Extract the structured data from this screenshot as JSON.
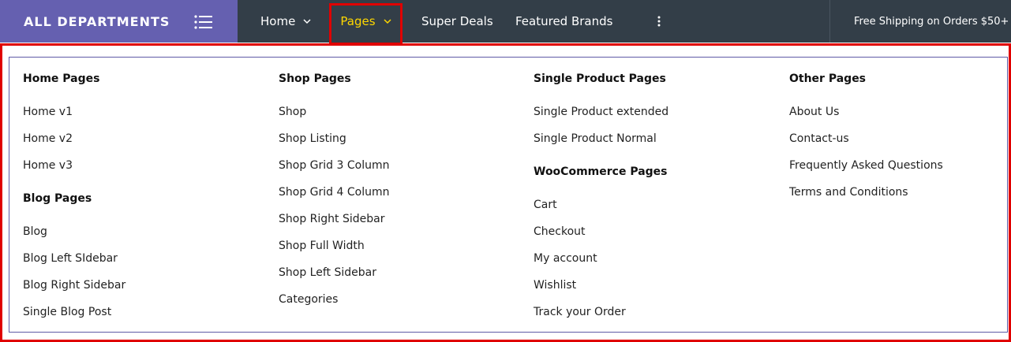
{
  "navbar": {
    "departments_label": "ALL DEPARTMENTS",
    "items": [
      {
        "label": "Home"
      },
      {
        "label": "Pages"
      },
      {
        "label": "Super Deals"
      },
      {
        "label": "Featured Brands"
      }
    ],
    "free_shipping": "Free Shipping on Orders $50+"
  },
  "menu": {
    "columns": [
      {
        "sections": [
          {
            "heading": "Home Pages",
            "links": [
              "Home v1",
              "Home v2",
              "Home v3"
            ]
          },
          {
            "heading": "Blog Pages",
            "links": [
              "Blog",
              "Blog Left SIdebar",
              "Blog Right Sidebar",
              "Single Blog Post"
            ]
          }
        ]
      },
      {
        "sections": [
          {
            "heading": "Shop Pages",
            "links": [
              "Shop",
              "Shop Listing",
              "Shop Grid 3 Column",
              "Shop Grid 4 Column",
              "Shop Right Sidebar",
              "Shop Full Width",
              "Shop Left Sidebar",
              "Categories"
            ]
          }
        ]
      },
      {
        "sections": [
          {
            "heading": "Single Product Pages",
            "links": [
              "Single Product extended",
              "Single Product Normal"
            ]
          },
          {
            "heading": "WooCommerce Pages",
            "links": [
              "Cart",
              "Checkout",
              "My account",
              "Wishlist",
              "Track your Order"
            ]
          }
        ]
      },
      {
        "sections": [
          {
            "heading": "Other Pages",
            "links": [
              "About Us",
              "Contact-us",
              "Frequently Asked Questions",
              "Terms and Conditions"
            ]
          }
        ]
      }
    ]
  },
  "colors": {
    "nav_bg": "#333e48",
    "departments_bg": "#6560b0",
    "active_nav": "#fed700",
    "highlight": "#e00000"
  }
}
